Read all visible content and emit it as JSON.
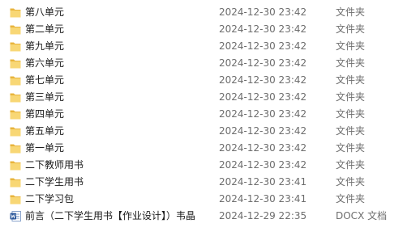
{
  "files": [
    {
      "name": "第八单元",
      "date": "2024-12-30 23:42",
      "type": "文件夹",
      "icon": "folder-icon"
    },
    {
      "name": "第二单元",
      "date": "2024-12-30 23:42",
      "type": "文件夹",
      "icon": "folder-icon"
    },
    {
      "name": "第九单元",
      "date": "2024-12-30 23:42",
      "type": "文件夹",
      "icon": "folder-icon"
    },
    {
      "name": "第六单元",
      "date": "2024-12-30 23:42",
      "type": "文件夹",
      "icon": "folder-icon"
    },
    {
      "name": "第七单元",
      "date": "2024-12-30 23:42",
      "type": "文件夹",
      "icon": "folder-icon"
    },
    {
      "name": "第三单元",
      "date": "2024-12-30 23:42",
      "type": "文件夹",
      "icon": "folder-icon"
    },
    {
      "name": "第四单元",
      "date": "2024-12-30 23:42",
      "type": "文件夹",
      "icon": "folder-icon"
    },
    {
      "name": "第五单元",
      "date": "2024-12-30 23:42",
      "type": "文件夹",
      "icon": "folder-icon"
    },
    {
      "name": "第一单元",
      "date": "2024-12-30 23:42",
      "type": "文件夹",
      "icon": "folder-icon"
    },
    {
      "name": "二下教师用书",
      "date": "2024-12-30 23:42",
      "type": "文件夹",
      "icon": "folder-icon"
    },
    {
      "name": "二下学生用书",
      "date": "2024-12-30 23:41",
      "type": "文件夹",
      "icon": "folder-icon"
    },
    {
      "name": "二下学习包",
      "date": "2024-12-30 23:41",
      "type": "文件夹",
      "icon": "folder-icon"
    },
    {
      "name": "前言（二下学生用书【作业设计】）韦晶",
      "date": "2024-12-29 22:35",
      "type": "DOCX 文档",
      "icon": "word-document-icon"
    }
  ],
  "colors": {
    "folder_body": "#f8d775",
    "folder_tab": "#e8b43c",
    "word_blue": "#2b579a",
    "secondary_text": "#6d6d6d"
  }
}
